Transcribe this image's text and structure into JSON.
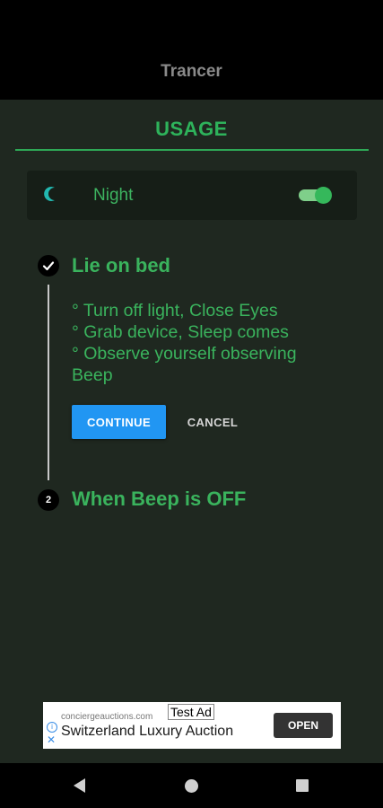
{
  "app": {
    "title": "Trancer"
  },
  "section": {
    "title": "USAGE"
  },
  "night": {
    "label": "Night",
    "toggle_on": true,
    "icon": "moon-icon"
  },
  "steps": [
    {
      "number": "",
      "state": "done",
      "title": "Lie on bed",
      "bullets": [
        "° Turn off light, Close Eyes",
        "° Grab device, Sleep comes",
        "° Observe yourself observing",
        "Beep"
      ],
      "continue_label": "CONTINUE",
      "cancel_label": "CANCEL"
    },
    {
      "number": "2",
      "state": "pending",
      "title": "When Beep is OFF"
    }
  ],
  "ad": {
    "domain": "conciergeauctions.com",
    "tag": "Test Ad",
    "headline": "Switzerland Luxury Auction",
    "cta": "OPEN"
  },
  "colors": {
    "accent": "#2eb35b",
    "background": "#1f2820",
    "card": "#161e17",
    "button": "#2196f3"
  }
}
